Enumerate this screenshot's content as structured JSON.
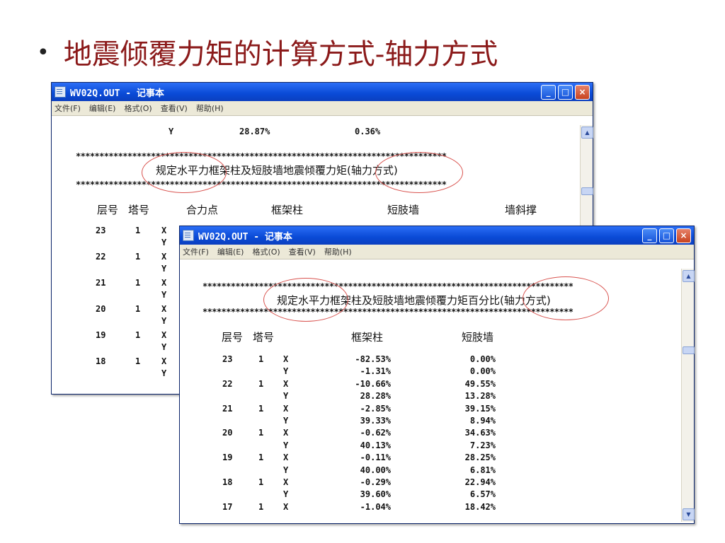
{
  "slide": {
    "bullet": "•",
    "title": "地震倾覆力矩的计算方式-轴力方式"
  },
  "window_back": {
    "title": "WV02Q.OUT - 记事本",
    "menu": [
      "文件(F)",
      "编辑(E)",
      "格式(O)",
      "查看(V)",
      "帮助(H)"
    ],
    "top_row": {
      "dir": "Y",
      "a": "28.87%",
      "b": "0.36%"
    },
    "stars": "*******************************************************************************",
    "heading": "规定水平力框架柱及短肢墙地震倾覆力矩(轴力方式)",
    "columns": [
      "层号",
      "塔号",
      "合力点",
      "框架柱",
      "短肢墙",
      "墙斜撑"
    ],
    "rows": [
      {
        "floor": "23",
        "tower": "1"
      },
      {
        "floor": "22",
        "tower": "1"
      },
      {
        "floor": "21",
        "tower": "1"
      },
      {
        "floor": "20",
        "tower": "1"
      },
      {
        "floor": "19",
        "tower": "1"
      },
      {
        "floor": "18",
        "tower": "1"
      }
    ],
    "dir_x": "X",
    "dir_y": "Y"
  },
  "window_front": {
    "title": "WV02Q.OUT - 记事本",
    "menu": [
      "文件(F)",
      "编辑(E)",
      "格式(O)",
      "查看(V)",
      "帮助(H)"
    ],
    "stars": "*******************************************************************************",
    "heading": "规定水平力框架柱及短肢墙地震倾覆力矩百分比(轴力方式)",
    "columns": [
      "层号",
      "塔号",
      "框架柱",
      "短肢墙"
    ],
    "rows": [
      {
        "floor": "23",
        "tower": "1",
        "dir": "X",
        "frame": "-82.53%",
        "short": "0.00%"
      },
      {
        "floor": "",
        "tower": "",
        "dir": "Y",
        "frame": "-1.31%",
        "short": "0.00%"
      },
      {
        "floor": "22",
        "tower": "1",
        "dir": "X",
        "frame": "-10.66%",
        "short": "49.55%"
      },
      {
        "floor": "",
        "tower": "",
        "dir": "Y",
        "frame": "28.28%",
        "short": "13.28%"
      },
      {
        "floor": "21",
        "tower": "1",
        "dir": "X",
        "frame": "-2.85%",
        "short": "39.15%"
      },
      {
        "floor": "",
        "tower": "",
        "dir": "Y",
        "frame": "39.33%",
        "short": "8.94%"
      },
      {
        "floor": "20",
        "tower": "1",
        "dir": "X",
        "frame": "-0.62%",
        "short": "34.63%"
      },
      {
        "floor": "",
        "tower": "",
        "dir": "Y",
        "frame": "40.13%",
        "short": "7.23%"
      },
      {
        "floor": "19",
        "tower": "1",
        "dir": "X",
        "frame": "-0.11%",
        "short": "28.25%"
      },
      {
        "floor": "",
        "tower": "",
        "dir": "Y",
        "frame": "40.00%",
        "short": "6.81%"
      },
      {
        "floor": "18",
        "tower": "1",
        "dir": "X",
        "frame": "-0.29%",
        "short": "22.94%"
      },
      {
        "floor": "",
        "tower": "",
        "dir": "Y",
        "frame": "39.60%",
        "short": "6.57%"
      },
      {
        "floor": "17",
        "tower": "1",
        "dir": "X",
        "frame": "-1.04%",
        "short": "18.42%"
      }
    ]
  },
  "buttons": {
    "minimize": "_",
    "maximize": "□",
    "close": "×"
  },
  "scroll": {
    "up": "▲",
    "down": "▼"
  },
  "colors": {
    "title_text": "#8b1a1a",
    "annotation_oval": "#d9534f",
    "titlebar": "#0a4ad6"
  }
}
